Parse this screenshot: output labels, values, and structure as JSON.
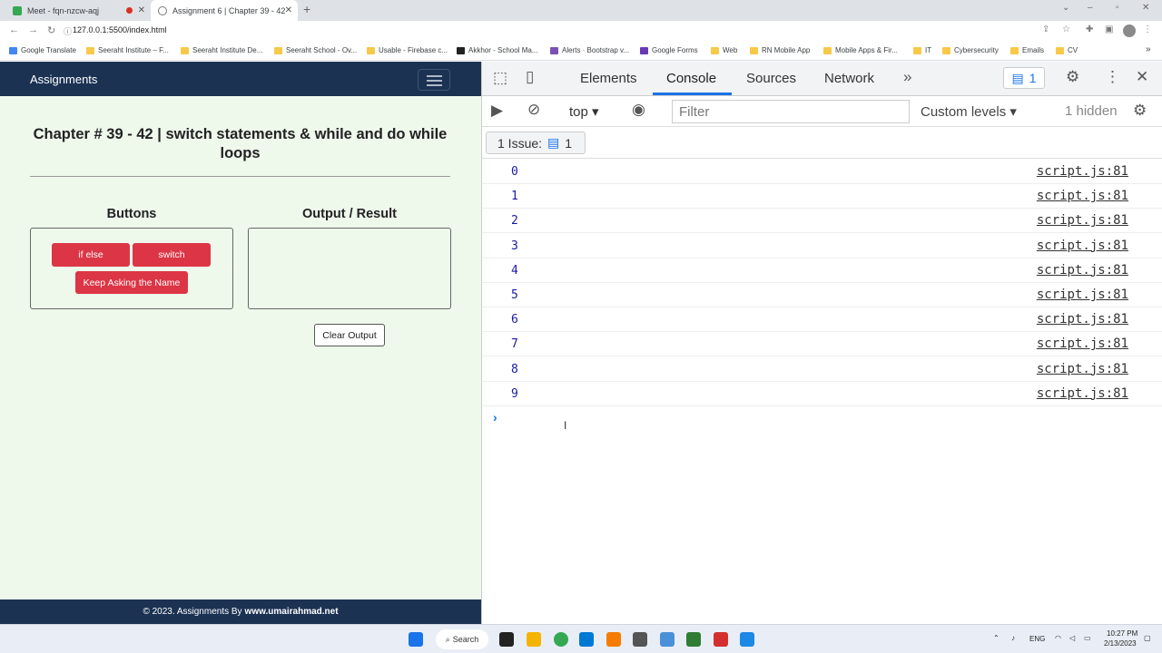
{
  "browser": {
    "tabs": [
      {
        "title": "Meet - fqn-nzcw-aqj"
      },
      {
        "title": "Assignment 6 | Chapter 39 - 42"
      }
    ],
    "url": "127.0.0.1:5500/index.html",
    "bookmarks": [
      "Google Translate",
      "Seeraht Institute – F...",
      "Seeraht Institute De...",
      "Seeraht School - Ov...",
      "Usable - Firebase c...",
      "Akkhor - School Ma...",
      "Alerts · Bootstrap v...",
      "Google Forms",
      "Web",
      "RN Mobile App",
      "Mobile Apps & Fir...",
      "IT",
      "Cybersecurity",
      "Emails",
      "CV"
    ]
  },
  "page": {
    "brand": "Assignments",
    "heading": "Chapter # 39 - 42 | switch statements & while and do while loops",
    "buttons_heading": "Buttons",
    "output_heading": "Output / Result",
    "btn_ifelse": "if else",
    "btn_switch": "switch",
    "btn_keep": "Keep Asking the Name",
    "btn_clear": "Clear Output",
    "footer_text": "© 2023. Assignments By",
    "footer_site": "www.umairahmad.net"
  },
  "devtools": {
    "tabs": [
      "Elements",
      "Console",
      "Sources",
      "Network"
    ],
    "issues_count": "1",
    "context": "top",
    "filter_placeholder": "Filter",
    "levels": "Custom levels",
    "hidden": "1 hidden",
    "issue_label": "1 Issue:",
    "issue_num": "1",
    "logs": [
      {
        "value": "0",
        "source": "script.js:81"
      },
      {
        "value": "1",
        "source": "script.js:81"
      },
      {
        "value": "2",
        "source": "script.js:81"
      },
      {
        "value": "3",
        "source": "script.js:81"
      },
      {
        "value": "4",
        "source": "script.js:81"
      },
      {
        "value": "5",
        "source": "script.js:81"
      },
      {
        "value": "6",
        "source": "script.js:81"
      },
      {
        "value": "7",
        "source": "script.js:81"
      },
      {
        "value": "8",
        "source": "script.js:81"
      },
      {
        "value": "9",
        "source": "script.js:81"
      }
    ]
  },
  "taskbar": {
    "search": "Search",
    "lang": "ENG",
    "time": "10:27 PM",
    "date": "2/13/2023"
  }
}
